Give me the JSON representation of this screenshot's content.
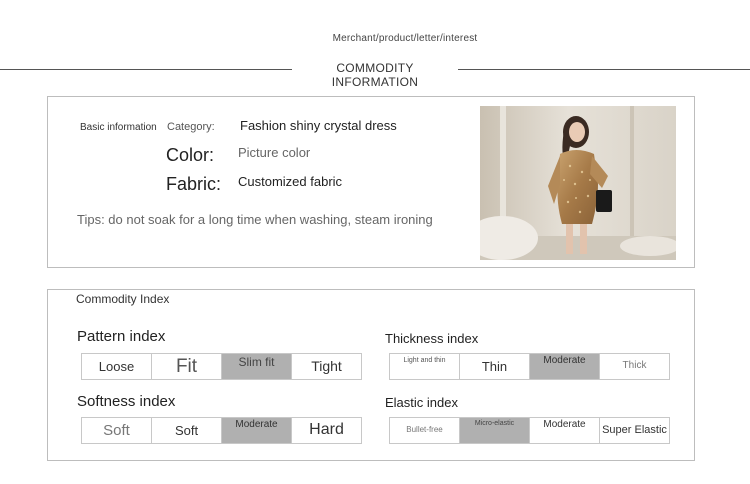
{
  "header": {
    "subtitle": "Merchant/product/letter/interest",
    "title": "COMMODITY INFORMATION"
  },
  "basic_info": {
    "section_label": "Basic information",
    "category_label": "Category:",
    "category_value": "Fashion shiny crystal dress",
    "color_label": "Color:",
    "color_value": "Picture color",
    "fabric_label": "Fabric:",
    "fabric_value": "Customized fabric",
    "tips": "Tips: do not soak for a long time when washing, steam ironing"
  },
  "commodity_index": {
    "title": "Commodity Index",
    "pattern": {
      "label": "Pattern index",
      "options": [
        "Loose",
        "Fit",
        "Slim fit",
        "Tight"
      ],
      "selected": 2
    },
    "thickness": {
      "label": "Thickness index",
      "options": [
        "Light and thin",
        "Thin",
        "Moderate",
        "Thick"
      ],
      "selected": 2
    },
    "softness": {
      "label": "Softness index",
      "options": [
        "Soft",
        "Soft",
        "Moderate",
        "Hard"
      ],
      "selected": 2
    },
    "elastic": {
      "label": "Elastic index",
      "options": [
        "Bullet-free",
        "Micro-elastic",
        "Moderate",
        "Super Elastic"
      ],
      "selected": 1
    }
  },
  "colors": {
    "selected_cell": "#b0b0b0",
    "border": "#bdbdbd"
  }
}
